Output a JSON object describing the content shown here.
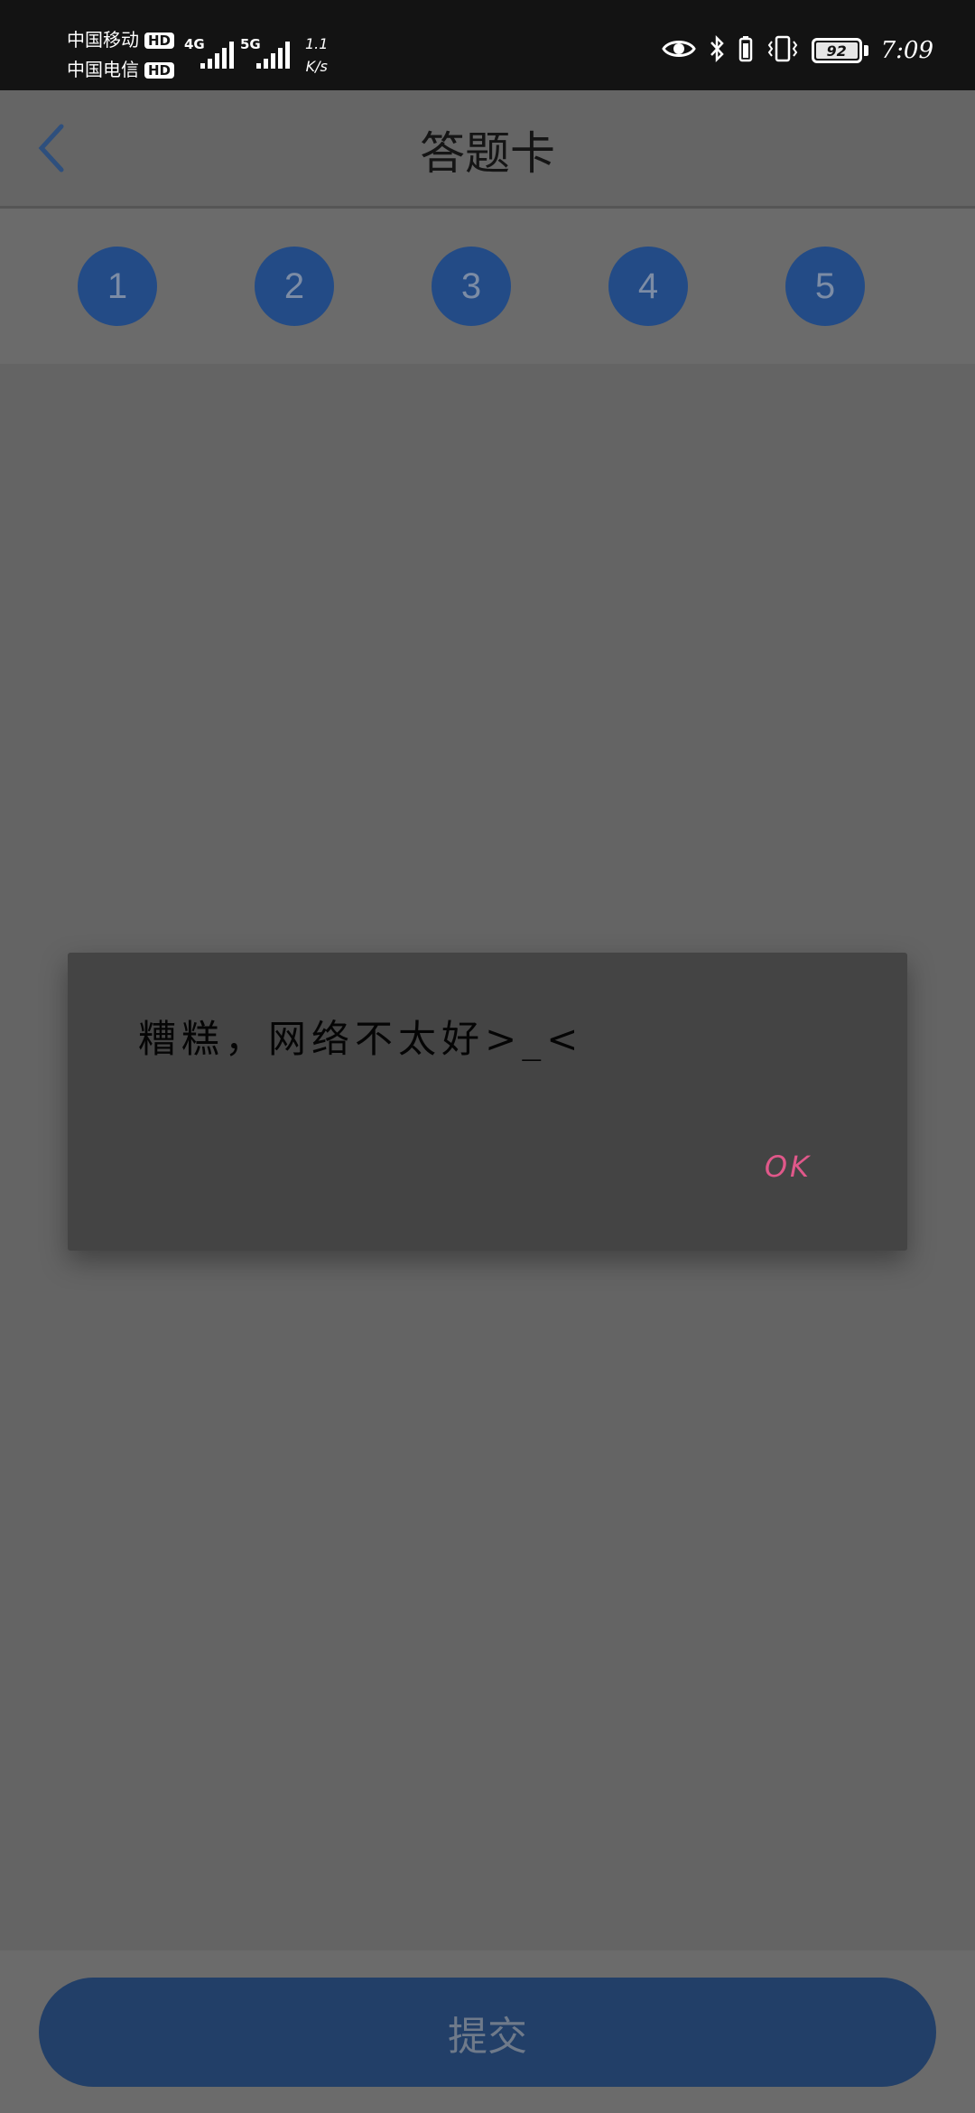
{
  "status_bar": {
    "carrier1": "中国移动",
    "carrier2": "中国电信",
    "hd_badge": "HD",
    "net1": "4G",
    "net2": "5G",
    "speed_value": "1.1",
    "speed_unit": "K/s",
    "battery_level": "92",
    "time": "7:09"
  },
  "header": {
    "title": "答题卡"
  },
  "questions": [
    "1",
    "2",
    "3",
    "4",
    "5"
  ],
  "dialog": {
    "message": "糟糕，网络不太好>_<",
    "ok_label": "OK"
  },
  "footer": {
    "submit_label": "提交"
  },
  "colors": {
    "accent_blue": "#234b86",
    "ok_pink": "#e0588a"
  }
}
